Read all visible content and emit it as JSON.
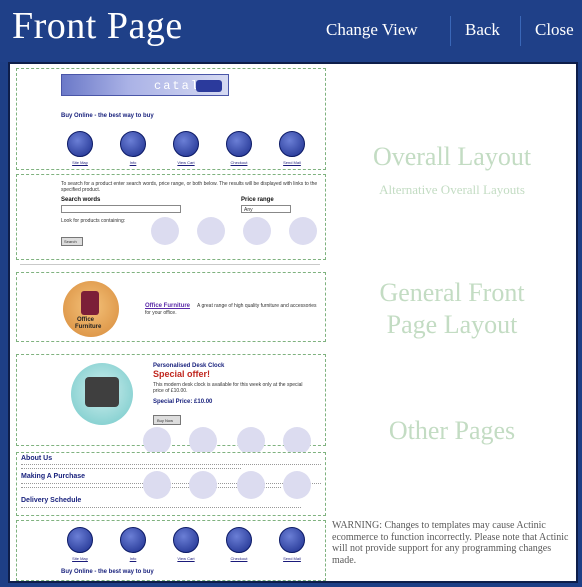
{
  "header": {
    "title": "Front Page",
    "change_view": "Change View",
    "back": "Back",
    "close": "Close"
  },
  "links": {
    "overall_layout": "Overall Layout",
    "alt_overall_layouts": "Alternative Overall Layouts",
    "general_front_1": "General Front",
    "general_front_2": "Page Layout",
    "other_pages": "Other Pages"
  },
  "warning": "WARNING: Changes to templates may cause Actinic ecommerce to function incorrectly. Please note that Actinic will not provide support for any programming changes made.",
  "preview": {
    "logo_text": "catalog",
    "tagline": "Buy Online - the best way to buy",
    "nav": [
      "Site Map",
      "Info",
      "View Cart",
      "Checkout",
      "Send Mail"
    ],
    "search_intro": "To search for a product enter search words, price range, or both below. The results will be displayed with links to the specified product.",
    "search_words_label": "Search words",
    "price_range_label": "Price range",
    "price_range_value": "Any",
    "look_for_label": "Look for products containing:",
    "search_button": "Search",
    "section_title": "Office Furniture",
    "section_text": "A great range of high quality furniture and accessories for your office.",
    "section_img_label_1": "Office",
    "section_img_label_2": "Furniture",
    "product_title": "Personalised Desk Clock",
    "product_special": "Special offer!",
    "product_desc": "This modern desk clock is available for this week only at the special price of £10.00.",
    "product_price": "Special Price: £10.00",
    "buy_now": "Buy Now",
    "about_title": "About Us",
    "making_title": "Making A Purchase",
    "delivery_title": "Delivery Schedule",
    "footer_tagline": "Buy Online - the best way to buy"
  }
}
